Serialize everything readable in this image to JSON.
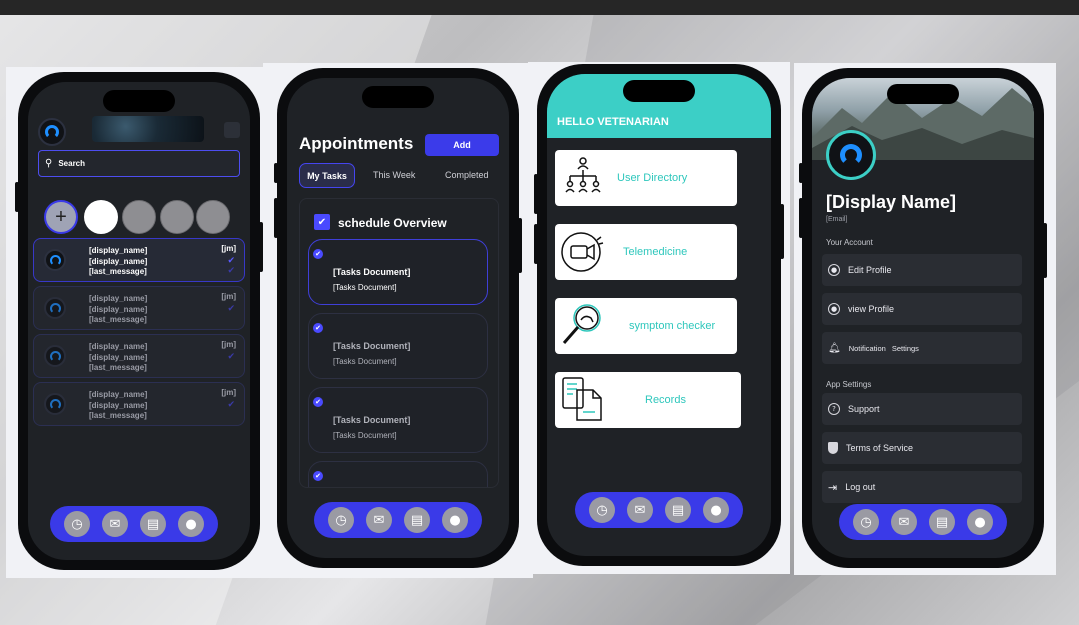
{
  "colors": {
    "accent": "#3a3ae8",
    "teal": "#3ccfc6",
    "screen_bg": "#1f2226"
  },
  "nav_icons": [
    "clock-icon",
    "chat-icon",
    "inbox-icon",
    "account-icon"
  ],
  "chat_screen": {
    "search_placeholder": "Search",
    "rows": [
      {
        "line1": "[display_name]",
        "line2": "[display_name]",
        "line3": "[last_message]",
        "tag": "[jm]"
      },
      {
        "line1": "[display_name]",
        "line2": "[display_name]",
        "line3": "[last_message]",
        "tag": "[jm]"
      },
      {
        "line1": "[display_name]",
        "line2": "[display_name]",
        "line3": "[last_message]",
        "tag": "[jm]"
      },
      {
        "line1": "[display_name]",
        "line2": "[display_name]",
        "line3": "[last_message]",
        "tag": "[jm]"
      }
    ],
    "add_story_symbol": "+"
  },
  "tasks_screen": {
    "title": "Appointments",
    "add_label": "Add",
    "tabs": [
      "My Tasks",
      "This Week",
      "Completed"
    ],
    "section_title": "schedule Overview",
    "cards": [
      {
        "title": "[Tasks Document]",
        "subtitle": "[Tasks Document]"
      },
      {
        "title": "[Tasks Document]",
        "subtitle": "[Tasks Document]"
      },
      {
        "title": "[Tasks Document]",
        "subtitle": "[Tasks Document]"
      }
    ]
  },
  "vet_screen": {
    "greeting": "HELLO VETENARIAN",
    "cards": [
      {
        "label": "User Directory",
        "icon": "org-chart-icon"
      },
      {
        "label": "Telemedicine",
        "icon": "video-call-icon"
      },
      {
        "label": "symptom checker",
        "icon": "magnifier-icon"
      },
      {
        "label": "Records",
        "icon": "documents-icon"
      }
    ]
  },
  "profile_screen": {
    "display_name": "[Display Name]",
    "email": "[Email]",
    "section_account": "Your Account",
    "edit_profile": "Edit Profile",
    "view_profile": "view Profile",
    "notification": "Notification",
    "settings": "Settings",
    "section_app": "App Settings",
    "support": "Support",
    "terms": "Terms of Service",
    "logout": "Log out"
  }
}
